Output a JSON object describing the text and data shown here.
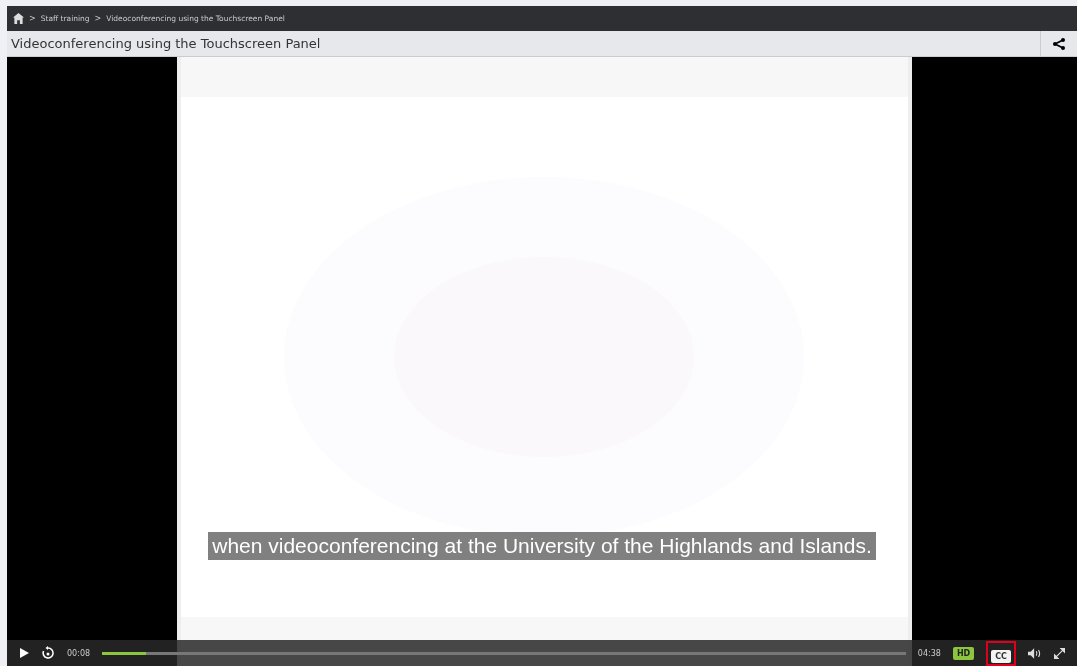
{
  "breadcrumb": [
    {
      "separator": ">",
      "label": "Staff training"
    },
    {
      "separator": ">",
      "label": "Videoconferencing using the Touchscreen Panel"
    }
  ],
  "title": "Videoconferencing using the Touchscreen Panel",
  "video": {
    "kind": "picture",
    "caption": "when videoconferencing at the University of the Highlands and Islands."
  },
  "controls": {
    "elapsed": "00:08",
    "duration": "04:38",
    "level": 0.055,
    "hd_label": "HD",
    "hd_on": true,
    "cc_label": "CC",
    "cc_highlighted": true
  }
}
